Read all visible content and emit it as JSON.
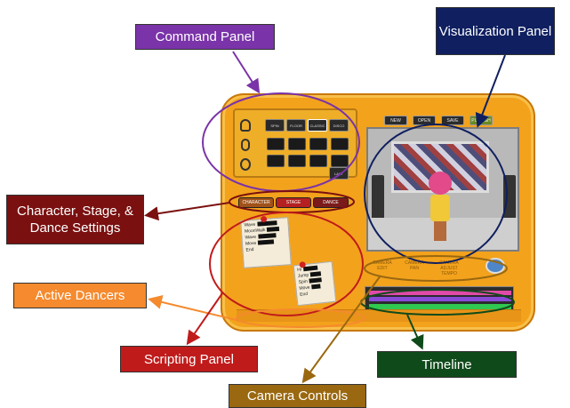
{
  "callouts": {
    "command_panel": "Command Panel",
    "visualization_panel": "Visualization Panel",
    "character_settings": "Character, Stage, & Dance Settings",
    "active_dancers": "Active Dancers",
    "scripting_panel": "Scripting Panel",
    "timeline": "Timeline",
    "camera_controls": "Camera Controls"
  },
  "colors": {
    "command": "#7a33a8",
    "visualization": "#0f1f60",
    "character": "#7a1010",
    "active": "#f58a2e",
    "scripting": "#c01b1b",
    "timeline": "#0f4a1a",
    "camera": "#9a6810",
    "app_body": "#f3a21c"
  },
  "app": {
    "toolbar": [
      "NEW",
      "OPEN",
      "SAVE",
      "PUBLISH"
    ],
    "command_buttons_top": [
      "SPIN",
      "FLOOR",
      "CLASSIC",
      "DISCO"
    ],
    "command_last": "LAST",
    "settings_buttons": [
      "CHARACTER",
      "STAGE",
      "DANCE"
    ],
    "camera_buttons": [
      "CAMERA EDIT",
      "CAMERA PAN",
      "CAMERA ADJUST TEMPO"
    ],
    "script_note_1": [
      "Wave",
      "MoonWalk",
      "Wave",
      "Move",
      "End"
    ],
    "script_note_2": [
      "Hi",
      "Jump",
      "Spin",
      "Move",
      "End"
    ]
  }
}
